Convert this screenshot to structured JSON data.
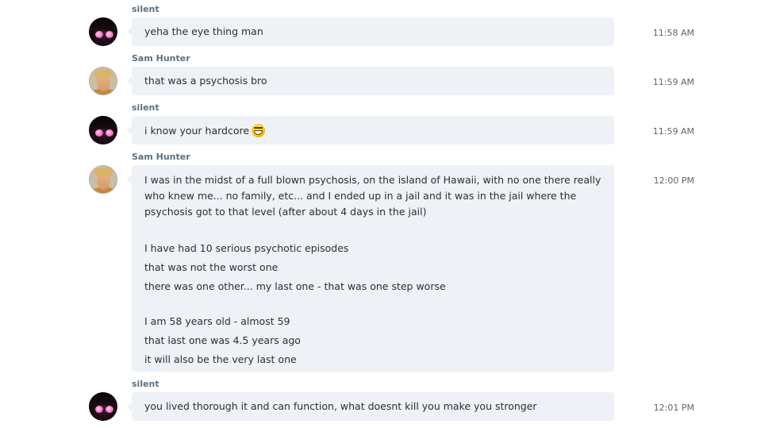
{
  "messages": [
    {
      "sender": "silent",
      "avatar": "silent-avatar",
      "lines": [
        "yeha the eye thing man"
      ],
      "time": "11:58 AM"
    },
    {
      "sender": "Sam Hunter",
      "avatar": "sam-hunter-avatar",
      "lines": [
        "that was a psychosis bro"
      ],
      "time": "11:59 AM"
    },
    {
      "sender": "silent",
      "avatar": "silent-avatar",
      "lines": [
        "i know your hardcore"
      ],
      "emoji": "grinning-face-emoji",
      "time": "11:59 AM"
    },
    {
      "sender": "Sam Hunter",
      "avatar": "sam-hunter-avatar",
      "lines": [
        "I was in the midst of a full blown psychosis, on the island of Hawaii, with no one there really",
        "who knew me... no family, etc...  and I ended up in a jail and it was in the jail where the",
        "psychosis got to that level (after about 4 days in the jail)",
        "I have had 10 serious psychotic episodes",
        "that was not the worst one",
        "there was one other... my last one - that was one step worse",
        "I am 58 years old - almost 59",
        "that last one was 4.5 years ago",
        "it will also be the very last one"
      ],
      "time": "12:00 PM"
    },
    {
      "sender": "silent",
      "avatar": "silent-avatar",
      "lines": [
        "you lived thorough it and can function, what doesnt kill you  make you stronger"
      ],
      "time": "12:01 PM"
    }
  ],
  "colors": {
    "bubble_bg": "#eef1f5",
    "sender_name": "#5c7080",
    "text": "#2b2f33",
    "time": "#5c6670"
  }
}
